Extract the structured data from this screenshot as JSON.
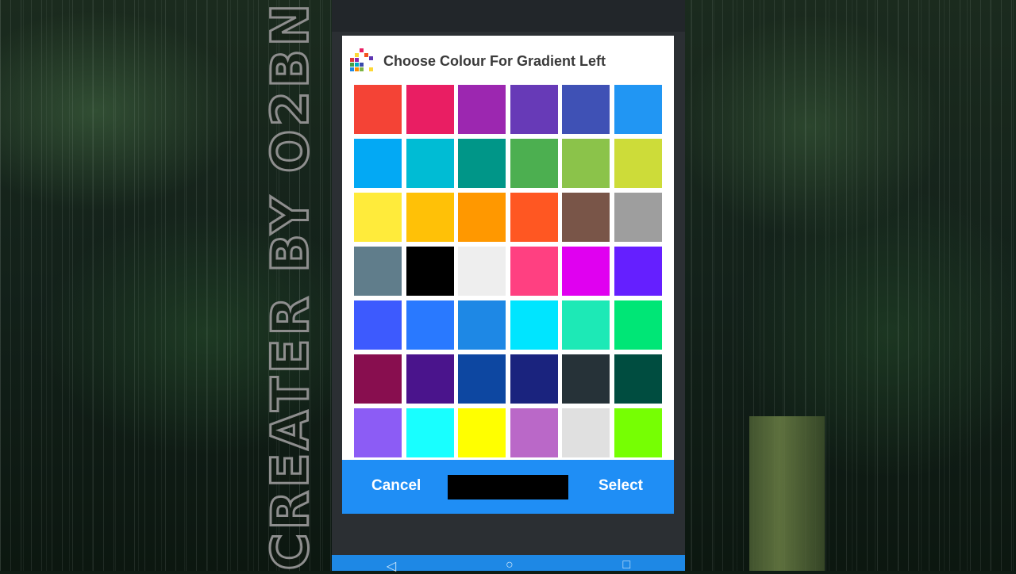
{
  "watermark": {
    "text": "CREATER BY O2BN"
  },
  "dialog": {
    "title": "Choose Colour For Gradient Left",
    "icon": "color-palette-icon",
    "swatches": [
      "#f44336",
      "#e91e63",
      "#9c27b0",
      "#673ab7",
      "#3f51b5",
      "#2196f3",
      "#03a9f4",
      "#00bcd4",
      "#009688",
      "#4caf50",
      "#8bc34a",
      "#cddc39",
      "#ffeb3b",
      "#ffc107",
      "#ff9800",
      "#ff5722",
      "#795548",
      "#9e9e9e",
      "#607d8b",
      "#000000",
      "#eeeeee",
      "#ff4081",
      "#e000f0",
      "#651fff",
      "#3d5afe",
      "#2979ff",
      "#1e88e5",
      "#00e5ff",
      "#1de9b6",
      "#00e676",
      "#880e4f",
      "#4a148c",
      "#0d47a1",
      "#1a237e",
      "#263238",
      "#004d40",
      "#8c5cf5",
      "#18ffff",
      "#ffff00",
      "#ba68c8",
      "#e0e0e0",
      "#76ff03"
    ],
    "selected_color": "#000000",
    "cancel_label": "Cancel",
    "select_label": "Select",
    "footer_color": "#1f8ef5"
  },
  "navigation": {
    "back_icon": "back-icon",
    "home_icon": "home-icon",
    "recents_icon": "recents-icon"
  }
}
